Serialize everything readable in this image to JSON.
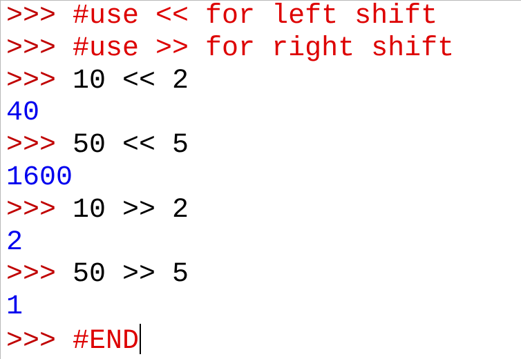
{
  "shell": {
    "prompt": ">>> ",
    "lines": [
      {
        "kind": "comment",
        "text": "#use << for left shift"
      },
      {
        "kind": "comment",
        "text": "#use >> for right shift"
      },
      {
        "kind": "input",
        "text": "10 << 2"
      },
      {
        "kind": "output",
        "text": "40"
      },
      {
        "kind": "input",
        "text": "50 << 5"
      },
      {
        "kind": "output",
        "text": "1600"
      },
      {
        "kind": "input",
        "text": "10 >> 2"
      },
      {
        "kind": "output",
        "text": "2"
      },
      {
        "kind": "input",
        "text": "50 >> 5"
      },
      {
        "kind": "output",
        "text": "1"
      },
      {
        "kind": "comment",
        "text": "#END"
      }
    ],
    "colors": {
      "prompt": "#c00000",
      "comment": "#dd0000",
      "code": "#000000",
      "output": "#0000ee",
      "background": "#ffffff"
    }
  }
}
